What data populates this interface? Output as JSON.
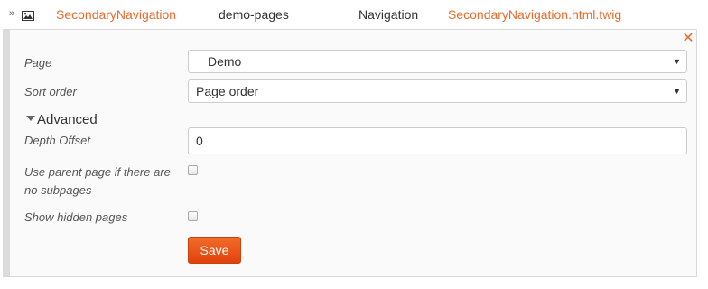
{
  "header": {
    "widget_name": "SecondaryNavigation",
    "page_slug": "demo-pages",
    "widget_type": "Navigation",
    "template": "SecondaryNavigation.html.twig"
  },
  "form": {
    "page": {
      "label": "Page",
      "value": "Demo"
    },
    "sort_order": {
      "label": "Sort order",
      "value": "Page order"
    },
    "advanced_label": "Advanced",
    "depth_offset": {
      "label": "Depth Offset",
      "value": "0"
    },
    "use_parent": {
      "label_line1": "Use parent page if there are",
      "label_line2": "no subpages"
    },
    "show_hidden": {
      "label": "Show hidden pages"
    },
    "save_label": "Save"
  },
  "colors": {
    "accent": "#e86a2c",
    "button": "#e8501a"
  },
  "icons": {
    "collapse": "double-chevron-down-icon",
    "image": "image-icon",
    "close": "close-icon",
    "dropdown": "dropdown-arrow-icon"
  }
}
